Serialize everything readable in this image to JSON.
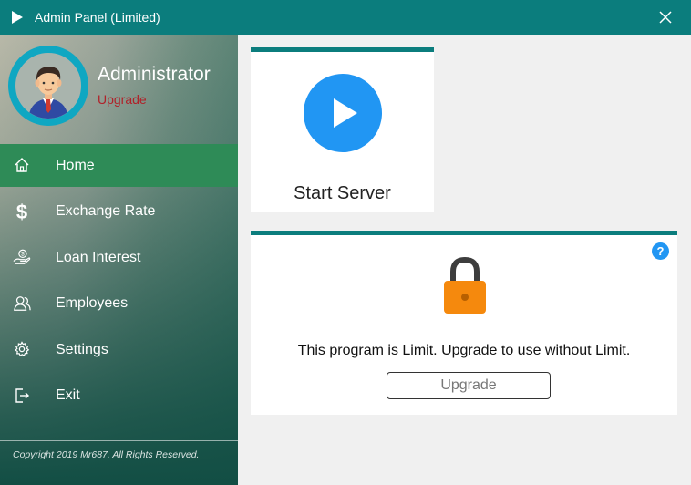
{
  "window": {
    "title": "Admin Panel (Limited)"
  },
  "profile": {
    "name": "Administrator",
    "upgrade_link": "Upgrade"
  },
  "sidebar": {
    "items": [
      {
        "label": "Home",
        "icon": "home-icon",
        "active": true
      },
      {
        "label": "Exchange Rate",
        "icon": "dollar-icon",
        "active": false
      },
      {
        "label": "Loan Interest",
        "icon": "money-hand-icon",
        "active": false
      },
      {
        "label": "Employees",
        "icon": "employees-icon",
        "active": false
      },
      {
        "label": "Settings",
        "icon": "gear-icon",
        "active": false
      },
      {
        "label": "Exit",
        "icon": "exit-icon",
        "active": false
      }
    ],
    "copyright": "Copyright 2019 Mr687. All Rights Reserved."
  },
  "start_card": {
    "label": "Start Server"
  },
  "limit_card": {
    "help": "?",
    "message": "This program is Limit. Upgrade to use without Limit.",
    "button_label": "Upgrade"
  },
  "colors": {
    "titlebar": "#0b7d7d",
    "active_nav": "#2e8b57",
    "accent_blue": "#2196f3",
    "lock_orange": "#f5890d",
    "upgrade_red": "#b0222a"
  }
}
